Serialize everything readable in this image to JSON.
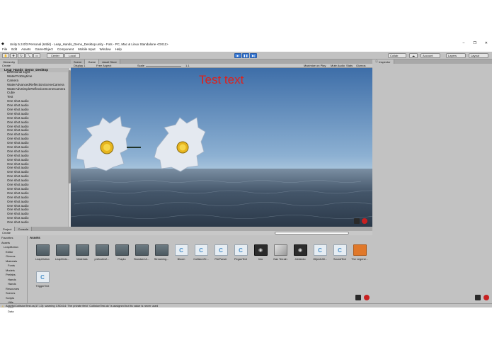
{
  "window": {
    "title": "Unity 5.3.0f3 Personal (64bit) - Leap_Hands_Demo_Desktop.unity - Fots - PC, Mac & Linux Standalone <DX11>",
    "minimize": "–",
    "maximize": "❐",
    "close": "✕"
  },
  "menu": [
    "File",
    "Edit",
    "Assets",
    "GameObject",
    "Component",
    "Mobile Input",
    "Window",
    "Help"
  ],
  "toolbar": {
    "center": "Center",
    "local": "Local",
    "collab": "Collab",
    "account": "Account",
    "layers": "Layers",
    "layout": "Layout"
  },
  "hierarchy": {
    "tab": "Hierarchy",
    "create": "Create",
    "scene": "Leap_Hands_Demo_Desktop",
    "items": [
      "Directional Light",
      "WaterProDaytime",
      "Camera",
      "WaterAdvancedReflectionSceneCamera",
      "WaterAdvSimpleReflectionSceneCamera",
      "Cube",
      "Test",
      "One shot audio",
      "One shot audio",
      "One shot audio",
      "One shot audio",
      "One shot audio",
      "One shot audio",
      "One shot audio",
      "One shot audio",
      "One shot audio",
      "One shot audio",
      "One shot audio",
      "One shot audio",
      "One shot audio",
      "One shot audio",
      "One shot audio",
      "One shot audio",
      "One shot audio",
      "One shot audio",
      "One shot audio",
      "One shot audio",
      "One shot audio",
      "One shot audio",
      "One shot audio",
      "One shot audio",
      "One shot audio",
      "One shot audio",
      "One shot audio",
      "One shot audio",
      "One shot audio",
      "One shot audio"
    ]
  },
  "viewTabs": [
    "Scene",
    "Game",
    "Asset Store"
  ],
  "game": {
    "display": "Display 1",
    "aspect": "Free Aspect",
    "scale_label": "Scale",
    "scale_value": "1.1",
    "maximize": "Maximize on Play",
    "mute": "Mute Audio",
    "stats": "Stats",
    "gizmos": "Gizmos",
    "overlay_text": "Test text"
  },
  "inspector": {
    "tab": "Inspector"
  },
  "project": {
    "tabs": [
      "Project",
      "Console"
    ],
    "create": "Create",
    "breadcrumb": "Assets",
    "tree": [
      "Favorites",
      "Assets",
      "LeapMotion",
      "Editor",
      "Gizmos",
      "Materials",
      "Fonts",
      "Models",
      "Prefabs",
      "Hands",
      "Hands",
      "Resources",
      "Scenes",
      "Scripts",
      "Utils",
      "Utils",
      "Data"
    ],
    "assets": [
      {
        "label": "LeapMotion",
        "kind": "folder"
      },
      {
        "label": "LeapMoto...",
        "kind": "folder"
      },
      {
        "label": "Materials",
        "kind": "folder"
      },
      {
        "label": "prefcutes2...",
        "kind": "folder"
      },
      {
        "label": "Prapto",
        "kind": "folder"
      },
      {
        "label": "Standard A...",
        "kind": "folder"
      },
      {
        "label": "Streaming...",
        "kind": "folder"
      },
      {
        "label": "Bloom",
        "kind": "script"
      },
      {
        "label": "CollisionTe...",
        "kind": "script"
      },
      {
        "label": "FileParser",
        "kind": "script"
      },
      {
        "label": "PeganText",
        "kind": "script"
      },
      {
        "label": "Imu",
        "kind": "dark"
      },
      {
        "label": "Nav Terrain",
        "kind": "cube"
      },
      {
        "label": "JobAndu",
        "kind": "dark"
      },
      {
        "label": "ObjectUtil...",
        "kind": "script"
      },
      {
        "label": "SoundText",
        "kind": "script"
      },
      {
        "label": "The Legend...",
        "kind": "orange"
      },
      {
        "label": "TriggerText",
        "kind": "script"
      }
    ]
  },
  "status": "Assets/CollisionTest.cs(17,13): warning CS0414: The private field `CollisionTest.dc' is assigned but its value is never used"
}
